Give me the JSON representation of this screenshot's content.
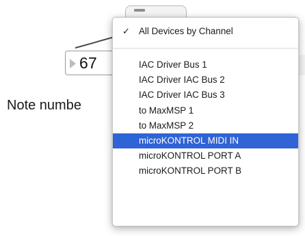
{
  "patcher": {
    "number_value": "67",
    "note_label": "Note numbe"
  },
  "menu": {
    "checked_item": "All Devices by Channel",
    "selected_index": 5,
    "items": [
      "IAC Driver Bus 1",
      "IAC Driver IAC Bus 2",
      "IAC Driver IAC Bus 3",
      "to MaxMSP 1",
      "to MaxMSP 2",
      "microKONTROL MIDI IN",
      "microKONTROL PORT A",
      "microKONTROL PORT B"
    ]
  },
  "colors": {
    "selection": "#2f63d6",
    "selection_text": "#ffffff"
  },
  "icons": {
    "check": "check-icon",
    "inlet": "triangle-icon"
  }
}
